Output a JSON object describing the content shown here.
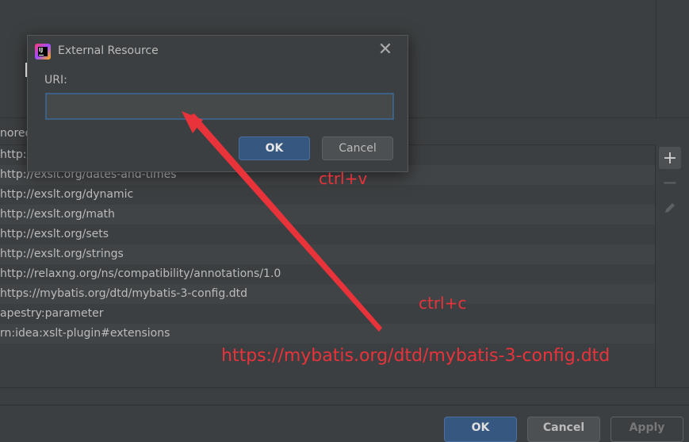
{
  "background": {
    "section_label": "nored",
    "list_items": [
      "http://",
      "http://exslt.org/dates-and-times",
      "http://exslt.org/dynamic",
      "http://exslt.org/math",
      "http://exslt.org/sets",
      "http://exslt.org/strings",
      "http://relaxng.org/ns/compatibility/annotations/1.0",
      "https://mybatis.org/dtd/mybatis-3-config.dtd",
      "apestry:parameter",
      "rn:idea:xslt-plugin#extensions"
    ],
    "tools": {
      "add": "+",
      "remove": "−",
      "edit": "✎"
    },
    "bottom_buttons": {
      "ok": "OK",
      "cancel": "Cancel",
      "apply": "Apply"
    }
  },
  "dialog": {
    "title": "External Resource",
    "app_icon": "intellij-icon",
    "app_icon_text": "IJ",
    "close": "✕",
    "uri_label": "URI:",
    "uri_value": "",
    "ok_label": "OK",
    "cancel_label": "Cancel"
  },
  "annotations": {
    "paste": "ctrl+v",
    "copy": "ctrl+c",
    "url": "https://mybatis.org/dtd/mybatis-3-config.dtd",
    "color": "#e8333a"
  }
}
